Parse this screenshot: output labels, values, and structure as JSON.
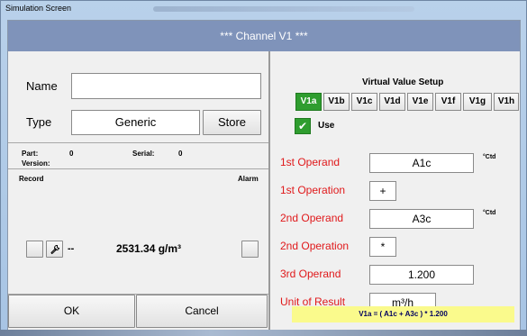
{
  "window": {
    "title": "Simulation Screen"
  },
  "header": {
    "title": "***   Channel V1   ***"
  },
  "left": {
    "name_label": "Name",
    "name_value": "",
    "type_label": "Type",
    "type_value": "Generic",
    "store_label": "Store",
    "part_label": "Part:",
    "part_value": "0",
    "serial_label": "Serial:",
    "serial_value": "0",
    "version_label": "Version:",
    "record_label": "Record",
    "alarm_label": "Alarm",
    "dashes": "--",
    "reading": "2531.34 g/m³",
    "ok_label": "OK",
    "cancel_label": "Cancel"
  },
  "right": {
    "title": "Virtual Value Setup",
    "tabs": [
      {
        "label": "V1a",
        "active": true
      },
      {
        "label": "V1b",
        "active": false
      },
      {
        "label": "V1c",
        "active": false
      },
      {
        "label": "V1d",
        "active": false
      },
      {
        "label": "V1e",
        "active": false
      },
      {
        "label": "V1f",
        "active": false
      },
      {
        "label": "V1g",
        "active": false
      },
      {
        "label": "V1h",
        "active": false
      }
    ],
    "use_label": "Use",
    "use_checked": true,
    "operand1_label": "1st Operand",
    "operand1_value": "A1c",
    "operand1_unit": "°Ctd",
    "operation1_label": "1st Operation",
    "operation1_value": "+",
    "operand2_label": "2nd Operand",
    "operand2_value": "A3c",
    "operand2_unit": "°Ctd",
    "operation2_label": "2nd Operation",
    "operation2_value": "*",
    "operand3_label": "3rd Operand",
    "operand3_value": "1.200",
    "unit_label": "Unit of Result",
    "unit_value": "m³/h",
    "formula": "V1a = ( A1c + A3c )  * 1.200"
  },
  "colors": {
    "header": "#7f93ba",
    "active_tab": "#2f9d2f",
    "operand_label": "#e0191b",
    "formula_bg": "#fafa8c"
  }
}
